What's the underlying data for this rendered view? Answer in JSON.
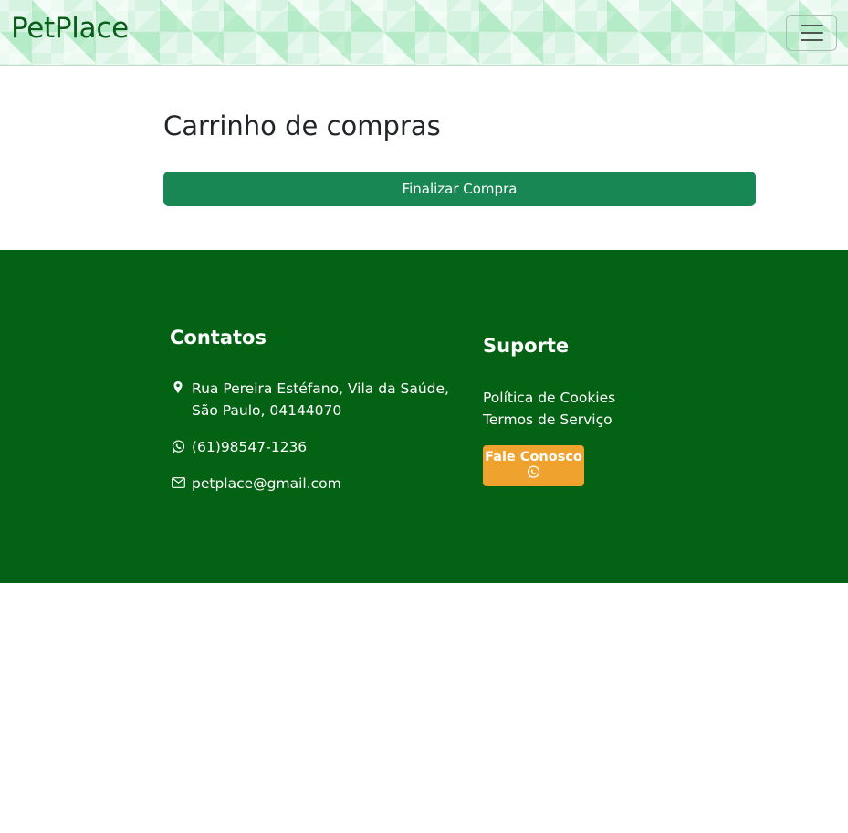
{
  "navbar": {
    "brand": "PetPlace",
    "toggler_icon": "hamburger-menu-icon"
  },
  "main": {
    "title": "Carrinho de compras",
    "checkout_label": "Finalizar Compra"
  },
  "footer": {
    "contacts": {
      "heading": "Contatos",
      "address": "Rua Pereira Estéfano, Vila da Saúde,\nSão Paulo, 04144070",
      "phone": "(61)98547-1236",
      "email": "petplace@gmail.com"
    },
    "support": {
      "heading": "Suporte",
      "links": [
        "Política de Cookies",
        "Termos de Serviço"
      ],
      "contact_button": "Fale Conosco"
    }
  },
  "colors": {
    "brand_text": "#0a5c1a",
    "primary_button": "#198754",
    "footer_bg": "#046214",
    "accent_button": "#f0a22e"
  }
}
